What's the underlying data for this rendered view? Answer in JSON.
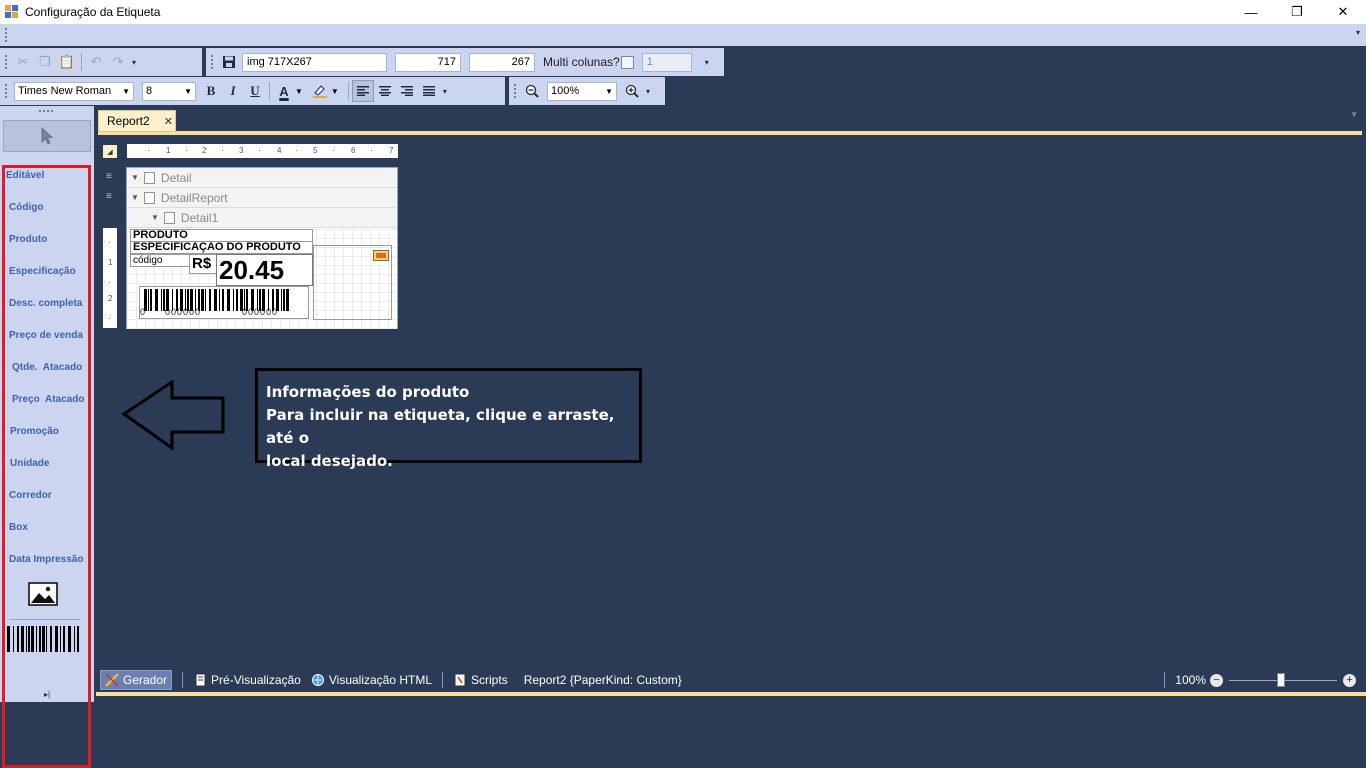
{
  "window": {
    "title": "Configuração da Etiqueta",
    "controls": {
      "minimize": "—",
      "restore": "❐",
      "close": "✕"
    }
  },
  "toolbar": {
    "label_name": "img 717X267",
    "width": "717",
    "height": "267",
    "multi_columns_label": "Multi colunas?",
    "multi_columns_checked": false,
    "columns_value": "1",
    "font_family": "Times New Roman",
    "font_size": "8",
    "bold": "B",
    "italic": "I",
    "underline": "U",
    "font_color_glyph": "A",
    "zoom": "100%"
  },
  "toolbox": {
    "items": [
      "Editável",
      "Código",
      "Produto",
      "Especificação",
      "Desc. completa",
      "Preço de venda",
      "Qtde.  Atacado",
      "Preço  Atacado",
      "Promoção",
      "Unidade",
      "Corredor",
      "Box",
      "Data Impressão"
    ],
    "image_icon": "image-icon",
    "barcode_icon": "barcode-icon"
  },
  "tabs": [
    {
      "label": "Report2",
      "close": "✕"
    }
  ],
  "ruler": {
    "h_ticks": [
      "1",
      "2",
      "3",
      "4",
      "5",
      "6",
      "7"
    ],
    "v_ticks": [
      "1",
      "2"
    ]
  },
  "designer": {
    "bands": [
      "Detail",
      "DetailReport",
      "Detail1"
    ],
    "label": {
      "produto": "PRODUTO",
      "especificacao": "ESPECIFICAÇÃO DO PRODUTO",
      "codigo": "código",
      "currency": "R$",
      "price": "20.45",
      "barcode_digits": [
        "0",
        "000000",
        "000000"
      ]
    }
  },
  "annotation": {
    "line1": "Informações do produto",
    "line2": "Para incluir na etiqueta, clique e arraste, até o",
    "line3": "local desejado."
  },
  "statusbar": {
    "items": [
      "Gerador",
      "Pré-Visualização",
      "Visualização HTML",
      "Scripts"
    ],
    "report_info": "Report2 {PaperKind: Custom}",
    "zoom": "100%"
  },
  "colors": {
    "background": "#2b3a55",
    "toolbar": "#ccd5f0",
    "accent_tab": "#f7df9e",
    "highlight_box": "#e21b23"
  }
}
